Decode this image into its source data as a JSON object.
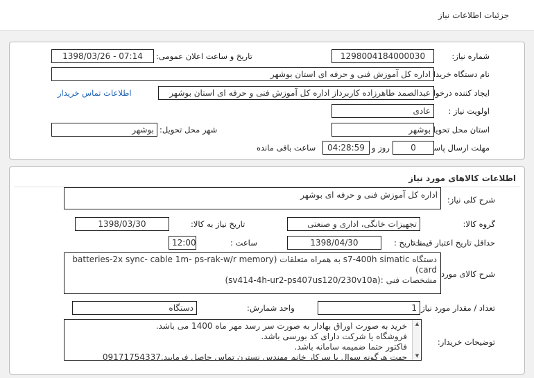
{
  "header": {
    "title": "جزئیات اطلاعات نیاز"
  },
  "details": {
    "need_number_label": "شماره نیاز:",
    "need_number": "1298004184000030",
    "announce_label": "تاریخ و ساعت اعلان عمومی:",
    "announce_value": "1398/03/26 - 07:14",
    "buyer_org_label": "نام دستگاه خریدار:",
    "buyer_org": "اداره کل آموزش فنی و حرفه ای استان بوشهر",
    "requester_label": "ایجاد کننده درخواست:",
    "requester": "عبدالصمد طاهرزاده کاربرداز اداره کل آموزش فنی و حرفه ای استان بوشهر",
    "contact_link": "اطلاعات تماس خریدار",
    "priority_label": "اولویت نیاز :",
    "priority": "عادی",
    "delivery_province_label": "استان محل تحویل:",
    "delivery_province": "بوشهر",
    "delivery_city_label": "شهر محل تحویل:",
    "delivery_city": "بوشهر",
    "deadline_label": "مهلت ارسال پاسخ:",
    "deadline_days": "0",
    "days_word": "روز و",
    "deadline_time": "04:28:59",
    "remaining_text": "ساعت باقی مانده"
  },
  "goods": {
    "section_title": "اطلاعات کالاهای مورد نیاز",
    "general_desc_label": "شرح کلی نیاز:",
    "general_desc": "اداره کل آموزش فنی و حرفه ای بوشهر",
    "group_label": "گروه کالا:",
    "group_value": "تجهیزات خانگی، اداری و صنعتی",
    "need_date_label": "تاریخ نیاز به کالا:",
    "need_date": "1398/03/30",
    "validity_label": "حداقل تاریخ اعتبار قیمت:",
    "to_date_label": "تا تاریخ :",
    "validity_date": "1398/04/30",
    "time_label": "ساعت :",
    "validity_time": "12:00",
    "goods_desc_label": "شرح کالای مورد نیاز:",
    "goods_desc_lines": [
      "دستگاه s7-400h simatic به همراه متعلقات (batteries-2x sync- cable 1m- ps-rak-w/r memory",
      "card)",
      "مشخصات فنی :(sv414-4h-ur2-ps407us120/230v10a)"
    ],
    "qty_label": "تعداد / مقدار مورد نیاز:",
    "qty_value": "1",
    "unit_label": "واحد شمارش:",
    "unit_value": "دستگاه",
    "buyer_notes_label": "توضیحات خریدار:",
    "buyer_notes_lines": [
      "خرید به صورت اوراق بهادار به صورت سر رسد مهر ماه 1400 می باشد.",
      "فروشگاه یا شرکت دارای کد بورسی باشد.",
      "فاکتور حتما ضمیمه سامانه باشد.",
      "جهت هرگونه سوال با سرکار خانم مهندس نسترن تماس حاصل فرمایید.09171754337"
    ]
  },
  "icons": {
    "scroll_up": "scroll-up-icon",
    "scroll_down": "scroll-down-icon"
  }
}
